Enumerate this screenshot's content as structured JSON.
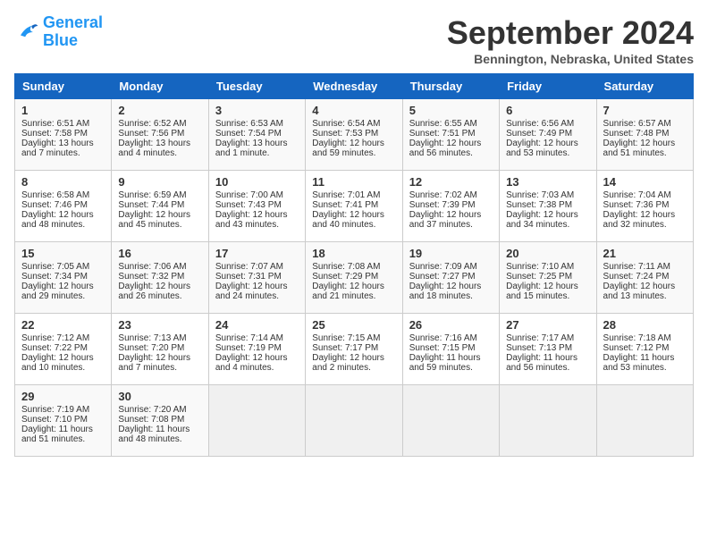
{
  "header": {
    "logo_line1": "General",
    "logo_line2": "Blue",
    "month_title": "September 2024",
    "location": "Bennington, Nebraska, United States"
  },
  "days_of_week": [
    "Sunday",
    "Monday",
    "Tuesday",
    "Wednesday",
    "Thursday",
    "Friday",
    "Saturday"
  ],
  "weeks": [
    [
      {
        "day": 1,
        "lines": [
          "Sunrise: 6:51 AM",
          "Sunset: 7:58 PM",
          "Daylight: 13 hours",
          "and 7 minutes."
        ]
      },
      {
        "day": 2,
        "lines": [
          "Sunrise: 6:52 AM",
          "Sunset: 7:56 PM",
          "Daylight: 13 hours",
          "and 4 minutes."
        ]
      },
      {
        "day": 3,
        "lines": [
          "Sunrise: 6:53 AM",
          "Sunset: 7:54 PM",
          "Daylight: 13 hours",
          "and 1 minute."
        ]
      },
      {
        "day": 4,
        "lines": [
          "Sunrise: 6:54 AM",
          "Sunset: 7:53 PM",
          "Daylight: 12 hours",
          "and 59 minutes."
        ]
      },
      {
        "day": 5,
        "lines": [
          "Sunrise: 6:55 AM",
          "Sunset: 7:51 PM",
          "Daylight: 12 hours",
          "and 56 minutes."
        ]
      },
      {
        "day": 6,
        "lines": [
          "Sunrise: 6:56 AM",
          "Sunset: 7:49 PM",
          "Daylight: 12 hours",
          "and 53 minutes."
        ]
      },
      {
        "day": 7,
        "lines": [
          "Sunrise: 6:57 AM",
          "Sunset: 7:48 PM",
          "Daylight: 12 hours",
          "and 51 minutes."
        ]
      }
    ],
    [
      {
        "day": 8,
        "lines": [
          "Sunrise: 6:58 AM",
          "Sunset: 7:46 PM",
          "Daylight: 12 hours",
          "and 48 minutes."
        ]
      },
      {
        "day": 9,
        "lines": [
          "Sunrise: 6:59 AM",
          "Sunset: 7:44 PM",
          "Daylight: 12 hours",
          "and 45 minutes."
        ]
      },
      {
        "day": 10,
        "lines": [
          "Sunrise: 7:00 AM",
          "Sunset: 7:43 PM",
          "Daylight: 12 hours",
          "and 43 minutes."
        ]
      },
      {
        "day": 11,
        "lines": [
          "Sunrise: 7:01 AM",
          "Sunset: 7:41 PM",
          "Daylight: 12 hours",
          "and 40 minutes."
        ]
      },
      {
        "day": 12,
        "lines": [
          "Sunrise: 7:02 AM",
          "Sunset: 7:39 PM",
          "Daylight: 12 hours",
          "and 37 minutes."
        ]
      },
      {
        "day": 13,
        "lines": [
          "Sunrise: 7:03 AM",
          "Sunset: 7:38 PM",
          "Daylight: 12 hours",
          "and 34 minutes."
        ]
      },
      {
        "day": 14,
        "lines": [
          "Sunrise: 7:04 AM",
          "Sunset: 7:36 PM",
          "Daylight: 12 hours",
          "and 32 minutes."
        ]
      }
    ],
    [
      {
        "day": 15,
        "lines": [
          "Sunrise: 7:05 AM",
          "Sunset: 7:34 PM",
          "Daylight: 12 hours",
          "and 29 minutes."
        ]
      },
      {
        "day": 16,
        "lines": [
          "Sunrise: 7:06 AM",
          "Sunset: 7:32 PM",
          "Daylight: 12 hours",
          "and 26 minutes."
        ]
      },
      {
        "day": 17,
        "lines": [
          "Sunrise: 7:07 AM",
          "Sunset: 7:31 PM",
          "Daylight: 12 hours",
          "and 24 minutes."
        ]
      },
      {
        "day": 18,
        "lines": [
          "Sunrise: 7:08 AM",
          "Sunset: 7:29 PM",
          "Daylight: 12 hours",
          "and 21 minutes."
        ]
      },
      {
        "day": 19,
        "lines": [
          "Sunrise: 7:09 AM",
          "Sunset: 7:27 PM",
          "Daylight: 12 hours",
          "and 18 minutes."
        ]
      },
      {
        "day": 20,
        "lines": [
          "Sunrise: 7:10 AM",
          "Sunset: 7:25 PM",
          "Daylight: 12 hours",
          "and 15 minutes."
        ]
      },
      {
        "day": 21,
        "lines": [
          "Sunrise: 7:11 AM",
          "Sunset: 7:24 PM",
          "Daylight: 12 hours",
          "and 13 minutes."
        ]
      }
    ],
    [
      {
        "day": 22,
        "lines": [
          "Sunrise: 7:12 AM",
          "Sunset: 7:22 PM",
          "Daylight: 12 hours",
          "and 10 minutes."
        ]
      },
      {
        "day": 23,
        "lines": [
          "Sunrise: 7:13 AM",
          "Sunset: 7:20 PM",
          "Daylight: 12 hours",
          "and 7 minutes."
        ]
      },
      {
        "day": 24,
        "lines": [
          "Sunrise: 7:14 AM",
          "Sunset: 7:19 PM",
          "Daylight: 12 hours",
          "and 4 minutes."
        ]
      },
      {
        "day": 25,
        "lines": [
          "Sunrise: 7:15 AM",
          "Sunset: 7:17 PM",
          "Daylight: 12 hours",
          "and 2 minutes."
        ]
      },
      {
        "day": 26,
        "lines": [
          "Sunrise: 7:16 AM",
          "Sunset: 7:15 PM",
          "Daylight: 11 hours",
          "and 59 minutes."
        ]
      },
      {
        "day": 27,
        "lines": [
          "Sunrise: 7:17 AM",
          "Sunset: 7:13 PM",
          "Daylight: 11 hours",
          "and 56 minutes."
        ]
      },
      {
        "day": 28,
        "lines": [
          "Sunrise: 7:18 AM",
          "Sunset: 7:12 PM",
          "Daylight: 11 hours",
          "and 53 minutes."
        ]
      }
    ],
    [
      {
        "day": 29,
        "lines": [
          "Sunrise: 7:19 AM",
          "Sunset: 7:10 PM",
          "Daylight: 11 hours",
          "and 51 minutes."
        ]
      },
      {
        "day": 30,
        "lines": [
          "Sunrise: 7:20 AM",
          "Sunset: 7:08 PM",
          "Daylight: 11 hours",
          "and 48 minutes."
        ]
      },
      null,
      null,
      null,
      null,
      null
    ]
  ]
}
